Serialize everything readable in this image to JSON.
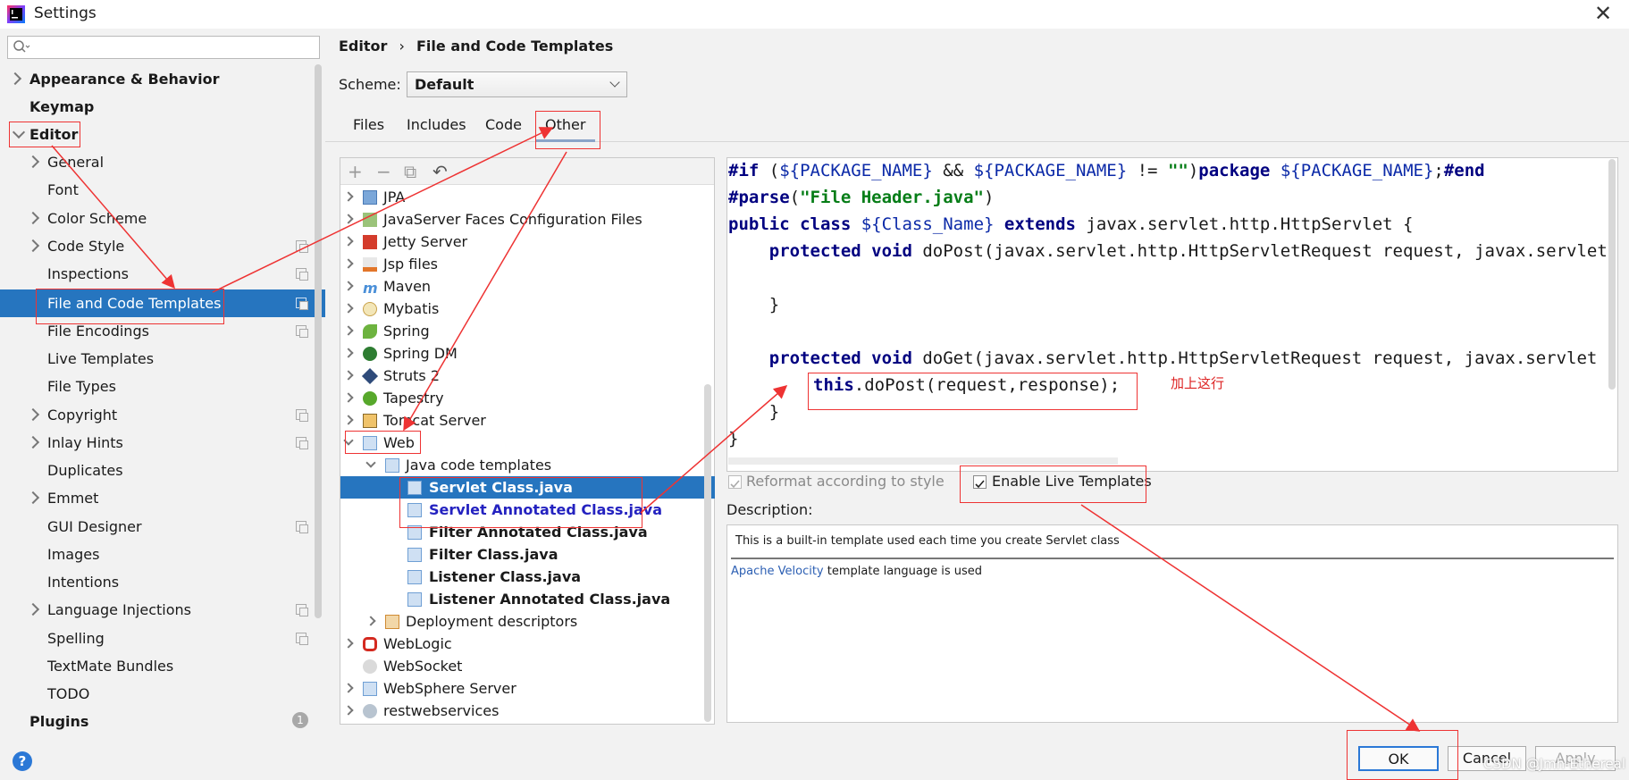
{
  "window": {
    "title": "Settings",
    "close": "✕"
  },
  "search": {
    "placeholder": ""
  },
  "sidebar": {
    "items": [
      {
        "label": "Appearance & Behavior"
      },
      {
        "label": "Keymap"
      },
      {
        "label": "Editor"
      },
      {
        "label": "General"
      },
      {
        "label": "Font"
      },
      {
        "label": "Color Scheme"
      },
      {
        "label": "Code Style"
      },
      {
        "label": "Inspections"
      },
      {
        "label": "File and Code Templates"
      },
      {
        "label": "File Encodings"
      },
      {
        "label": "Live Templates"
      },
      {
        "label": "File Types"
      },
      {
        "label": "Copyright"
      },
      {
        "label": "Inlay Hints"
      },
      {
        "label": "Duplicates"
      },
      {
        "label": "Emmet"
      },
      {
        "label": "GUI Designer"
      },
      {
        "label": "Images"
      },
      {
        "label": "Intentions"
      },
      {
        "label": "Language Injections"
      },
      {
        "label": "Spelling"
      },
      {
        "label": "TextMate Bundles"
      },
      {
        "label": "TODO"
      },
      {
        "label": "Plugins"
      }
    ],
    "plugins_badge": "1",
    "help": "?"
  },
  "breadcrumb": {
    "parent": "Editor",
    "sep": "›",
    "current": "File and Code Templates"
  },
  "scheme": {
    "label": "Scheme:",
    "value": "Default"
  },
  "tabs": [
    "Files",
    "Includes",
    "Code",
    "Other"
  ],
  "toolbar": {
    "add": "+",
    "remove": "−",
    "copy": "⧉",
    "reset": "↶"
  },
  "tree": {
    "items": [
      {
        "label": "JPA"
      },
      {
        "label": "JavaServer Faces Configuration Files"
      },
      {
        "label": "Jetty Server"
      },
      {
        "label": "Jsp files"
      },
      {
        "label": "Maven"
      },
      {
        "label": "Mybatis"
      },
      {
        "label": "Spring"
      },
      {
        "label": "Spring DM"
      },
      {
        "label": "Struts 2"
      },
      {
        "label": "Tapestry"
      },
      {
        "label": "Tomcat Server"
      },
      {
        "label": "Web"
      },
      {
        "label": "Java code templates"
      },
      {
        "label": "Servlet Class.java"
      },
      {
        "label": "Servlet Annotated Class.java"
      },
      {
        "label": "Filter Annotated Class.java"
      },
      {
        "label": "Filter Class.java"
      },
      {
        "label": "Listener Class.java"
      },
      {
        "label": "Listener Annotated Class.java"
      },
      {
        "label": "Deployment descriptors"
      },
      {
        "label": "WebLogic"
      },
      {
        "label": "WebSocket"
      },
      {
        "label": "WebSphere Server"
      },
      {
        "label": "restwebservices"
      }
    ]
  },
  "code": {
    "l1": {
      "a": "#if",
      "b": " (",
      "c": "${PACKAGE_NAME}",
      "d": " && ",
      "e": "${PACKAGE_NAME}",
      "f": " != ",
      "g": "\"\"",
      "h": ")",
      "i": "package",
      "j": " ",
      "k": "${PACKAGE_NAME}",
      "l": ";",
      "m": "#end"
    },
    "l2": {
      "a": "#parse",
      "b": "(",
      "c": "\"File Header.java\"",
      "d": ")"
    },
    "l3": {
      "a": "public class",
      "b": " ",
      "c": "${Class_Name}",
      "d": " ",
      "e": "extends",
      "f": " javax.servlet.http.HttpServlet {"
    },
    "l4": {
      "a": "    ",
      "b": "protected void",
      "c": " doPost(javax.servlet.http.HttpServletRequest request, javax.servlet"
    },
    "l5": "    }",
    "l6": {
      "a": "    ",
      "b": "protected void",
      "c": " doGet(javax.servlet.http.HttpServletRequest request, javax.servlet"
    },
    "l7": {
      "a": "this",
      "b": ".doPost(request,response);"
    },
    "l8": "    }",
    "l9": "}"
  },
  "annotation": "加上这行",
  "options": {
    "reformat": "Reformat according to style",
    "live": "Enable Live Templates",
    "reformat_checked": true,
    "live_checked": true
  },
  "description": {
    "label": "Description:",
    "text": "This is a built-in template used each time you create Servlet class",
    "link": "Apache Velocity",
    "suffix": " template language is used"
  },
  "buttons": {
    "ok": "OK",
    "cancel": "Cancel",
    "apply": "Apply"
  },
  "watermark": "CSDN @Jmh-Ethereal",
  "colors": {
    "selection": "#2675bf",
    "annotation": "#e33333",
    "link": "#2c5fb3"
  }
}
